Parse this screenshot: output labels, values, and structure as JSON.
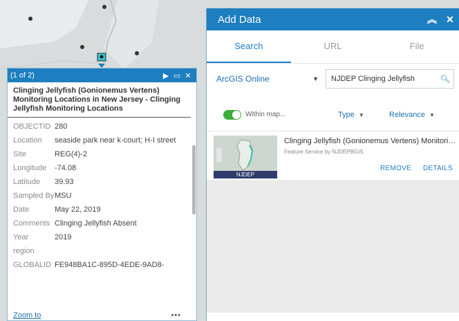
{
  "popup": {
    "count": "(1 of 2)",
    "title": "Clinging Jellyfish (Gonionemus Vertens) Monitoring Locations in New Jersey - Clinging Jellyfish Monitoring Locations",
    "attributes": [
      {
        "key": "OBJECTID",
        "value": "280"
      },
      {
        "key": "Location",
        "value": "seaside park near k-court; H-I street"
      },
      {
        "key": "Site",
        "value": "REG(4)-2"
      },
      {
        "key": "Longitude",
        "value": "-74.08"
      },
      {
        "key": "Latitude",
        "value": "39.93"
      },
      {
        "key": "Sampled By",
        "value": "MSU"
      },
      {
        "key": "Date",
        "value": "May 22, 2019"
      },
      {
        "key": "Comments",
        "value": "Clinging Jellyfish Absent"
      },
      {
        "key": "Year",
        "value": "2019"
      },
      {
        "key": "region",
        "value": ""
      },
      {
        "key": "GLOBALID",
        "value": "FE948BA1C-895D-4EDE-9AD8-"
      }
    ],
    "zoom_to": "Zoom to",
    "more": "•••",
    "next_icon": "▶",
    "maximize_icon": "▭",
    "close_icon": "✕"
  },
  "panel": {
    "title": "Add Data",
    "collapse_icon": "︽",
    "close_icon": "✕",
    "tabs": [
      "Search",
      "URL",
      "File"
    ],
    "source": "ArcGIS Online",
    "search_value": "NJDEP Clinging Jellyfish",
    "within_map": "Within map...",
    "type_filter": "Type",
    "relevance_filter": "Relevance",
    "result": {
      "title": "Clinging Jellyfish (Gonionemus Vertens) Monitoring Locations in New Jersey",
      "subtitle": "Feature Service by NJDEPBGIS",
      "thumb_label": "NJDEP",
      "remove": "REMOVE",
      "details": "DETAILS"
    }
  },
  "colors": {
    "accent": "#1d7ec0",
    "toggle_on": "#3dad3b",
    "map_land": "#d9dcdc",
    "map_water": "#e9ecee"
  }
}
